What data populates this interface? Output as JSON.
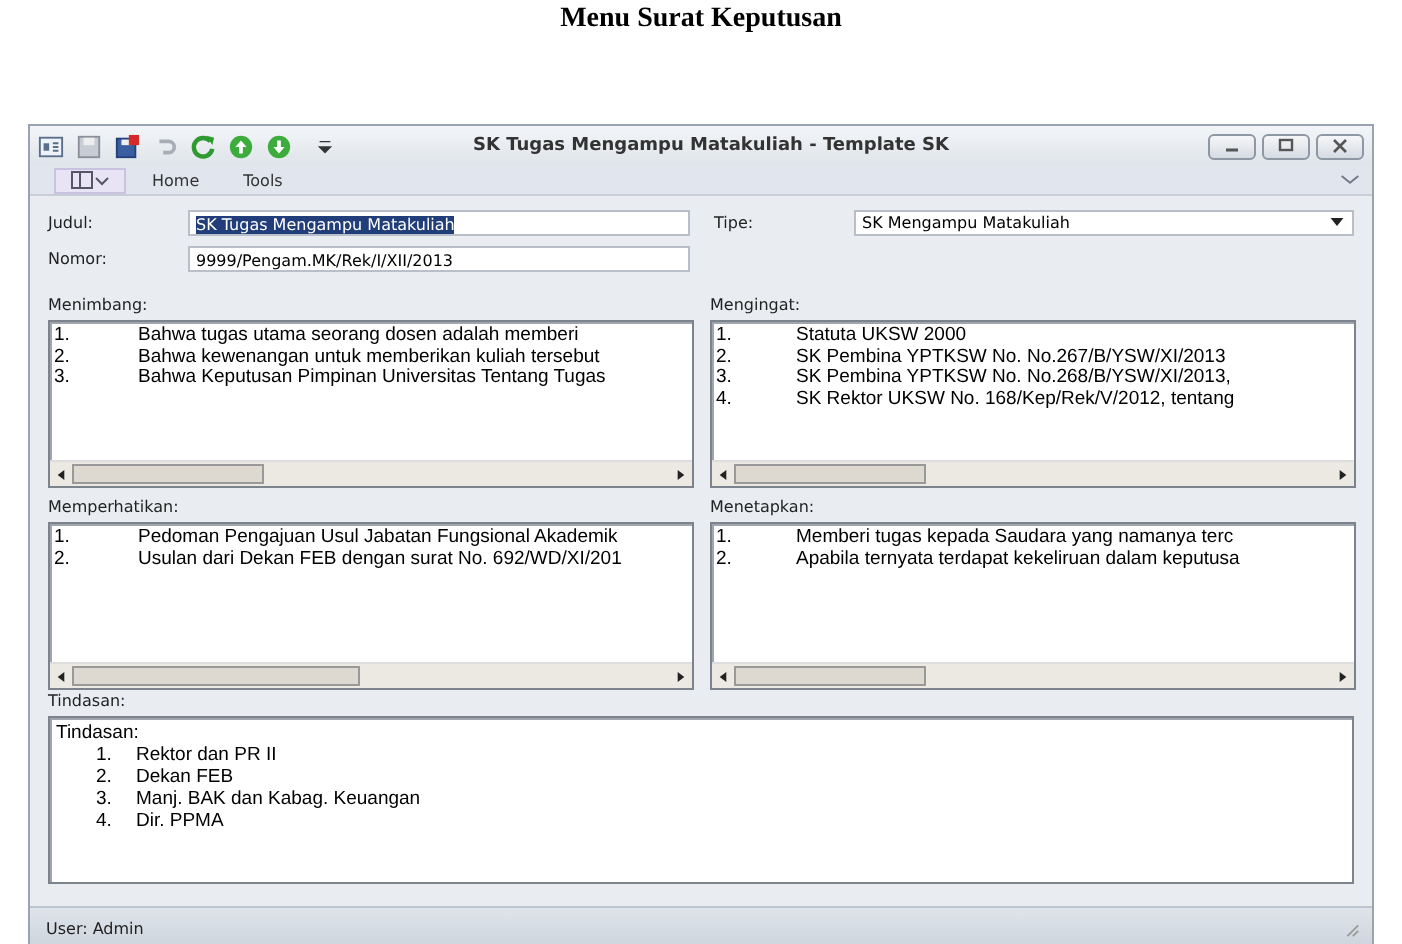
{
  "caption": "Menu Surat Keputusan",
  "window": {
    "title": "SK Tugas Mengampu Matakuliah - Template SK"
  },
  "ribbon_tabs": [
    {
      "label": "Home",
      "selected": false
    },
    {
      "label": "Tools",
      "selected": false
    }
  ],
  "fields": {
    "judul": {
      "label": "Judul:",
      "value": "SK Tugas Mengampu Matakuliah",
      "text_selected": true
    },
    "nomor": {
      "label": "Nomor:",
      "value": "9999/Pengam.MK/Rek/I/XII/2013"
    },
    "tipe": {
      "label": "Tipe:",
      "value": "SK Mengampu Matakuliah"
    }
  },
  "panels": [
    {
      "label": "Menimbang:",
      "items": [
        {
          "number": "1.",
          "text": "Bahwa tugas utama seorang dosen adalah memberi"
        },
        {
          "number": "2.",
          "text": "Bahwa kewenangan untuk memberikan kuliah tersebut"
        },
        {
          "number": "3.",
          "text": "Bahwa Keputusan Pimpinan Universitas Tentang Tugas"
        }
      ]
    },
    {
      "label": "Mengingat:",
      "items": [
        {
          "number": "1.",
          "text": "Statuta UKSW 2000"
        },
        {
          "number": "2.",
          "text": "SK Pembina YPTKSW No. No.267/B/YSW/XI/2013"
        },
        {
          "number": "3.",
          "text": "SK Pembina YPTKSW No. No.268/B/YSW/XI/2013,"
        },
        {
          "number": "4.",
          "text": "SK Rektor UKSW No. 168/Kep/Rek/V/2012, tentang"
        }
      ]
    },
    {
      "label": "Memperhatikan:",
      "items": [
        {
          "number": "1.",
          "text": "Pedoman Pengajuan Usul Jabatan Fungsional Akademik"
        },
        {
          "number": "2.",
          "text": "Usulan dari Dekan FEB dengan surat No. 692/WD/XI/201"
        }
      ]
    },
    {
      "label": "Menetapkan:",
      "items": [
        {
          "number": "1.",
          "text": "Memberi tugas kepada Saudara yang namanya terc"
        },
        {
          "number": "2.",
          "text": "Apabila ternyata terdapat kekeliruan dalam keputusa"
        }
      ]
    }
  ],
  "tindasan": {
    "label": "Tindasan:",
    "heading": "Tindasan:",
    "items": [
      {
        "number": "1.",
        "text": "Rektor dan PR II"
      },
      {
        "number": "2.",
        "text": "Dekan FEB"
      },
      {
        "number": "3.",
        "text": "Manj. BAK dan Kabag. Keuangan"
      },
      {
        "number": "4.",
        "text": "Dir. PPMA"
      }
    ]
  },
  "status_bar": "User: Admin"
}
